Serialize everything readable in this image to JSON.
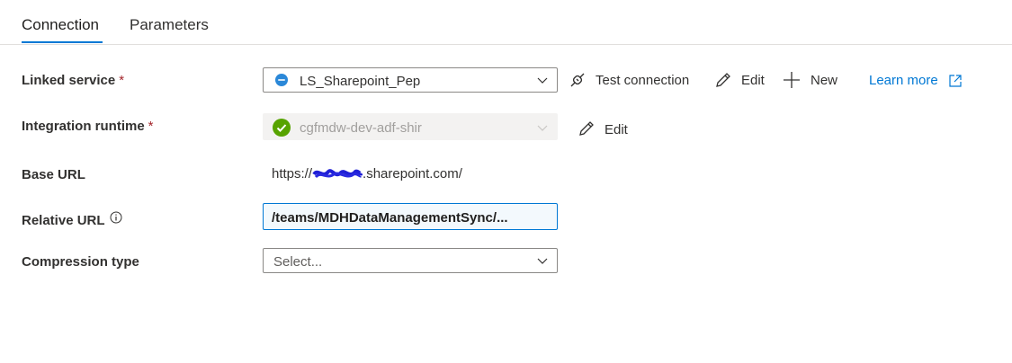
{
  "tabs": [
    {
      "label": "Connection",
      "active": true
    },
    {
      "label": "Parameters",
      "active": false
    }
  ],
  "linked_service": {
    "label": "Linked service",
    "required_marker": "*",
    "value": "LS_Sharepoint_Pep",
    "actions": {
      "test_connection": "Test connection",
      "edit": "Edit",
      "new": "New",
      "learn_more": "Learn more"
    }
  },
  "integration_runtime": {
    "label": "Integration runtime",
    "required_marker": "*",
    "value": "cgfmdw-dev-adf-shir",
    "edit": "Edit"
  },
  "base_url": {
    "label": "Base URL",
    "prefix": "https://",
    "suffix": ".sharepoint.com/"
  },
  "relative_url": {
    "label": "Relative URL",
    "value": "/teams/MDHDataManagementSync/..."
  },
  "compression_type": {
    "label": "Compression type",
    "placeholder": "Select..."
  },
  "colors": {
    "accent": "#0078d4",
    "required": "#a4262c",
    "status_ok": "#57a300",
    "disabled_bg": "#f3f2f1"
  }
}
